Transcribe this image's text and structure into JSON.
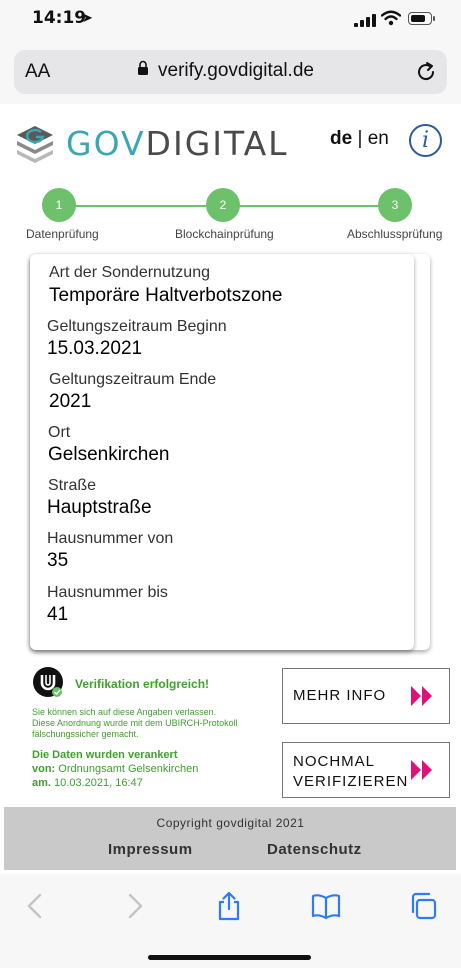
{
  "status": {
    "time": "14:19",
    "battery_level": 0.8
  },
  "browser": {
    "text_size_label": "AA",
    "url": "verify.govdigital.de"
  },
  "header": {
    "brand_part1": "GOV",
    "brand_part2": "DIGITAL",
    "lang_de": "de",
    "lang_sep": "|",
    "lang_en": "en",
    "info_glyph": "i"
  },
  "stepper": {
    "color": "#6cc16a",
    "steps": [
      {
        "number": "1",
        "label": "Datenprüfung"
      },
      {
        "number": "2",
        "label": "Blockchainprüfung"
      },
      {
        "number": "3",
        "label": "Abschlussprüfung"
      }
    ]
  },
  "fields": [
    {
      "label": "Art der Sondernutzung",
      "value": "Temporäre Haltverbotszone"
    },
    {
      "label": "Geltungszeitraum Beginn",
      "value": "15.03.2021"
    },
    {
      "label": "Geltungszeitraum Ende",
      "value": "2021"
    },
    {
      "label": "Ort",
      "value": "Gelsenkirchen"
    },
    {
      "label": "Straße",
      "value": "Hauptstraße"
    },
    {
      "label": "Hausnummer von",
      "value": "35"
    },
    {
      "label": "Hausnummer bis",
      "value": "41"
    }
  ],
  "verification": {
    "success": "Verifikation erfolgreich!",
    "note_lines": [
      "Sie können sich auf diese Angaben verlassen.",
      "Diese Anordnung wurde mit dem UBIRCH-Protokoll",
      "fälschungssicher gemacht."
    ],
    "anchored_heading": "Die Daten wurden verankert",
    "from_label": "von:",
    "from_value": "Ordnungsamt Gelsenkirchen",
    "at_label": "am.",
    "at_value": "10.03.2021, 16:47"
  },
  "buttons": {
    "more_info": "MEHR INFO",
    "reverify_line1": "NOCHMAL",
    "reverify_line2": "VERIFIZIEREN"
  },
  "footer": {
    "copyright": "Copyright govdigital 2021",
    "impressum": "Impressum",
    "datenschutz": "Datenschutz"
  },
  "colors": {
    "accent_green": "#3fa12d",
    "arrow_magenta": "#e0117a",
    "brand_teal": "#3aa7b5",
    "ios_blue": "#2f7bf5"
  }
}
